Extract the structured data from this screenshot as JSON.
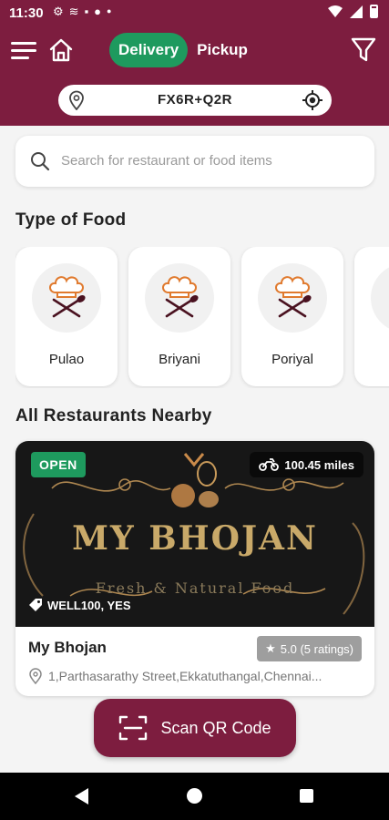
{
  "status_bar": {
    "time": "11:30",
    "left_icons": [
      "settings-icon",
      "network-icon",
      "bag-icon",
      "chat-icon",
      "dot-icon"
    ],
    "right_icons": [
      "wifi-icon",
      "signal-icon",
      "battery-icon"
    ]
  },
  "header": {
    "background_color": "#7d1d3f",
    "tabs": [
      {
        "label": "Delivery",
        "active": true
      },
      {
        "label": "Pickup",
        "active": false
      }
    ],
    "active_tab_color": "#1e9a5e",
    "location": "FX6R+Q2R"
  },
  "search": {
    "placeholder": "Search for restaurant or food items"
  },
  "food_types": {
    "title": "Type of Food",
    "items": [
      {
        "label": "Pulao",
        "icon": "chef-hat-utensils-icon"
      },
      {
        "label": "Briyani",
        "icon": "chef-hat-utensils-icon"
      },
      {
        "label": "Poriyal",
        "icon": "chef-hat-utensils-icon"
      }
    ]
  },
  "restaurants": {
    "title": "All Restaurants Nearby",
    "items": [
      {
        "status": "OPEN",
        "distance": "100.45 miles",
        "offer": "WELL100, YES",
        "banner_title": "MY BHOJAN",
        "banner_subtitle": "Fresh & Natural Food",
        "name": "My Bhojan",
        "rating": "5.0 (5 ratings)",
        "address": "1,Parthasarathy Street,Ekkatuthangal,Chennai..."
      }
    ]
  },
  "scan_button": {
    "label": "Scan QR Code"
  }
}
